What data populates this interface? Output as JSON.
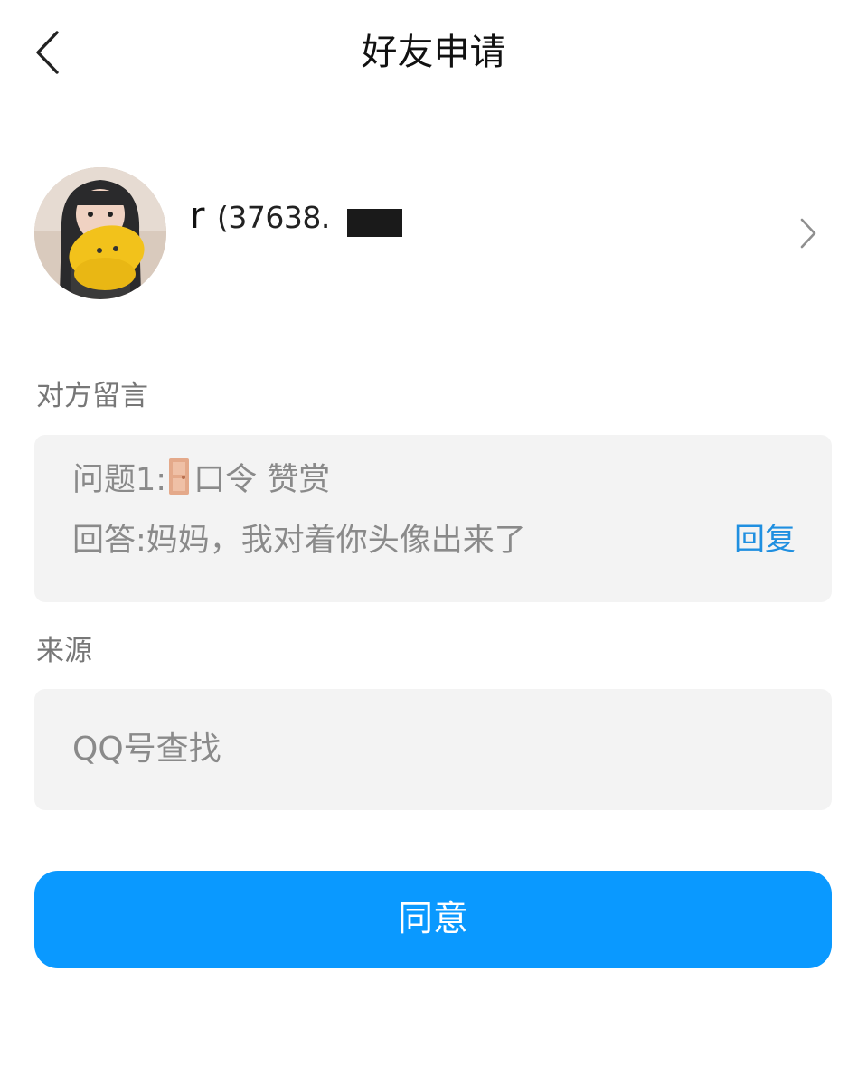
{
  "header": {
    "title": "好友申请",
    "back_icon": "chevron-left-icon"
  },
  "profile": {
    "nickname": "r",
    "qq_number": "(37638.",
    "avatar_icon": "avatar-photo",
    "chevron_icon": "chevron-right-icon"
  },
  "message_section": {
    "label": "对方留言",
    "question_prefix": "问题1:",
    "question_text": "口令 赞赏",
    "answer": "回答:妈妈，我对着你头像出来了",
    "reply_label": "回复",
    "door_icon": "door-icon"
  },
  "source_section": {
    "label": "来源",
    "value": "QQ号查找"
  },
  "actions": {
    "agree_label": "同意"
  },
  "colors": {
    "accent": "#0a99ff",
    "link": "#1f8fe0",
    "box_bg": "#f3f3f3",
    "label_gray": "#777777"
  }
}
